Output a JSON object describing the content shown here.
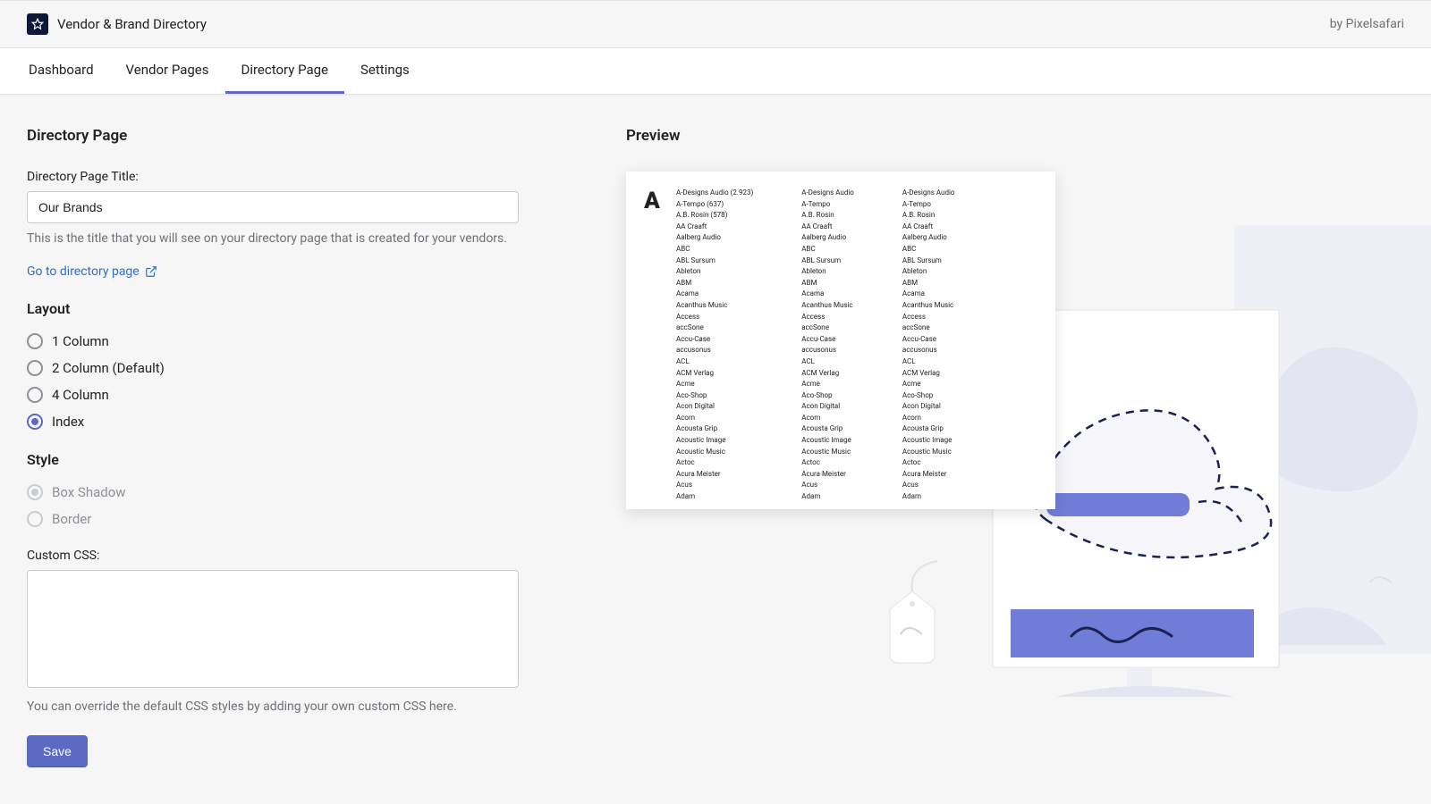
{
  "header": {
    "app_title": "Vendor & Brand Directory",
    "byline": "by Pixelsafari"
  },
  "tabs": [
    {
      "label": "Dashboard",
      "active": false
    },
    {
      "label": "Vendor Pages",
      "active": false
    },
    {
      "label": "Directory Page",
      "active": true
    },
    {
      "label": "Settings",
      "active": false
    }
  ],
  "page": {
    "title": "Directory Page",
    "field_title_label": "Directory Page Title:",
    "field_title_value": "Our Brands",
    "field_title_help": "This is the title that you will see on your directory page that is created for your vendors.",
    "go_link": "Go to directory page",
    "layout_title": "Layout",
    "layout_options": [
      {
        "label": "1 Column",
        "checked": false
      },
      {
        "label": "2 Column (Default)",
        "checked": false
      },
      {
        "label": "4 Column",
        "checked": false
      },
      {
        "label": "Index",
        "checked": true
      }
    ],
    "style_title": "Style",
    "style_options": [
      {
        "label": "Box Shadow",
        "checked": true,
        "disabled": true
      },
      {
        "label": "Border",
        "checked": false,
        "disabled": true
      }
    ],
    "css_label": "Custom CSS:",
    "css_value": "",
    "css_help": "You can override the default CSS styles by adding your own custom CSS here.",
    "save_label": "Save"
  },
  "preview": {
    "title": "Preview",
    "letter": "A",
    "col1": [
      "A-Designs Audio (2.923)",
      "A-Tempo (637)",
      "A.B. Rosin (578)",
      "AA Craaft",
      "Aalberg Audio",
      "ABC",
      "ABL Sursum",
      "Ableton",
      "ABM",
      "Acama",
      "Acanthus Music",
      "Access",
      "accSone",
      "Accu-Case",
      "accusonus",
      "ACL",
      "ACM Verlag",
      "Acme",
      "Aco-Shop",
      "Acon Digital",
      "Acorn",
      "Acousta Grip",
      "Acoustic Image",
      "Acoustic Music",
      "Actoc",
      "Acura Meister",
      "Acus",
      "Adam"
    ],
    "col2": [
      "A-Designs Audio",
      "A-Tempo",
      "A.B. Rosin",
      "AA Craaft",
      "Aalberg Audio",
      "ABC",
      "ABL Sursum",
      "Ableton",
      "ABM",
      "Acama",
      "Acanthus Music",
      "Access",
      "accSone",
      "Accu-Case",
      "accusonus",
      "ACL",
      "ACM Verlag",
      "Acme",
      "Aco-Shop",
      "Acon Digital",
      "Acorn",
      "Acousta Grip",
      "Acoustic Image",
      "Acoustic Music",
      "Actoc",
      "Acura Meister",
      "Acus",
      "Adam"
    ],
    "col3": [
      "A-Designs Audio",
      "A-Tempo",
      "A.B. Rosin",
      "AA Craaft",
      "Aalberg Audio",
      "ABC",
      "ABL Sursum",
      "Ableton",
      "ABM",
      "Acama",
      "Acanthus Music",
      "Access",
      "accSone",
      "Accu-Case",
      "accusonus",
      "ACL",
      "ACM Verlag",
      "Acme",
      "Aco-Shop",
      "Acon Digital",
      "Acorn",
      "Acousta Grip",
      "Acoustic Image",
      "Acoustic Music",
      "Actoc",
      "Acura Meister",
      "Acus",
      "Adam"
    ]
  }
}
